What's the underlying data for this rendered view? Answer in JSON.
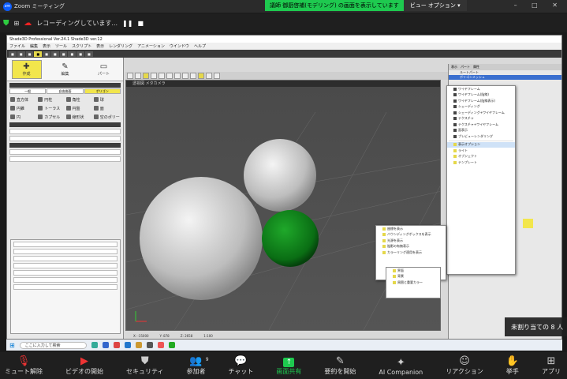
{
  "zoom": {
    "window_title": "Zoom ミーティング",
    "share_banner": "議師 御厨啓補(モデリング) の画面を表示しています",
    "view_options": "ビュー オプション",
    "recording_text": "レコーディングしています...",
    "bottom_bar": [
      {
        "label": "ミュート解除",
        "icon": "mic-muted-icon"
      },
      {
        "label": "ビデオの開始",
        "icon": "video-off-icon"
      },
      {
        "label": "セキュリティ",
        "icon": "shield-icon"
      },
      {
        "label": "参加者",
        "icon": "participants-icon",
        "count": "9"
      },
      {
        "label": "チャット",
        "icon": "chat-icon"
      },
      {
        "label": "画面共有",
        "icon": "share-screen-icon"
      },
      {
        "label": "要約を開始",
        "icon": "summary-icon"
      },
      {
        "label": "AI Companion",
        "icon": "ai-companion-icon"
      },
      {
        "label": "リアクション",
        "icon": "reaction-icon"
      },
      {
        "label": "挙手",
        "icon": "raise-hand-icon"
      },
      {
        "label": "アプリ",
        "icon": "apps-icon"
      }
    ],
    "notice": "未割り当ての 8 人"
  },
  "shade": {
    "title": "Shade3D Professional Ver.24.1 Shade3D ver.12",
    "menu": [
      "ファイル",
      "編集",
      "表示",
      "ツール",
      "スクリプト",
      "表示",
      "レンダリング",
      "アニメーション",
      "ウインドウ",
      "ヘルプ"
    ],
    "modes": [
      {
        "label": "作成",
        "icon": "create-icon",
        "active": true
      },
      {
        "label": "編集",
        "icon": "edit-icon",
        "active": false
      },
      {
        "label": "パート",
        "icon": "part-icon",
        "active": false
      }
    ],
    "tabs": [
      "一般",
      "自由曲面",
      "ポリゴン"
    ],
    "tools": [
      "直方体",
      "円柱",
      "角柱",
      "球",
      "円錐",
      "トーラス",
      "円盤",
      "面",
      "円",
      "カプセル",
      "線形状",
      "空のポリー"
    ],
    "viewport_title": "透視図 メタカメラ",
    "status": [
      "X: -15000",
      "Y: 878",
      "Z: 2658",
      "1:100"
    ],
    "context_menu": [
      "ワイヤフレーム",
      "ワイヤフレーム(陰線)",
      "ワイヤフレーム(陰線表示)",
      "シェーディング",
      "シェーディング+ワイヤフレーム",
      "テクスチャ",
      "テクスチャ+ワイヤフレーム",
      "面表示",
      "プレビューレンダリング",
      "表示オプション",
      "ライト",
      "オブジェクト",
      "テンプレート"
    ],
    "submenu": [
      "座標を表示",
      "バウンディングボックスを表示",
      "光源を表示",
      "陰影の有無表示",
      "カラーリング適用を表示"
    ],
    "submenu2": [
      "界面",
      "背景",
      "周囲と重要カラー"
    ]
  }
}
